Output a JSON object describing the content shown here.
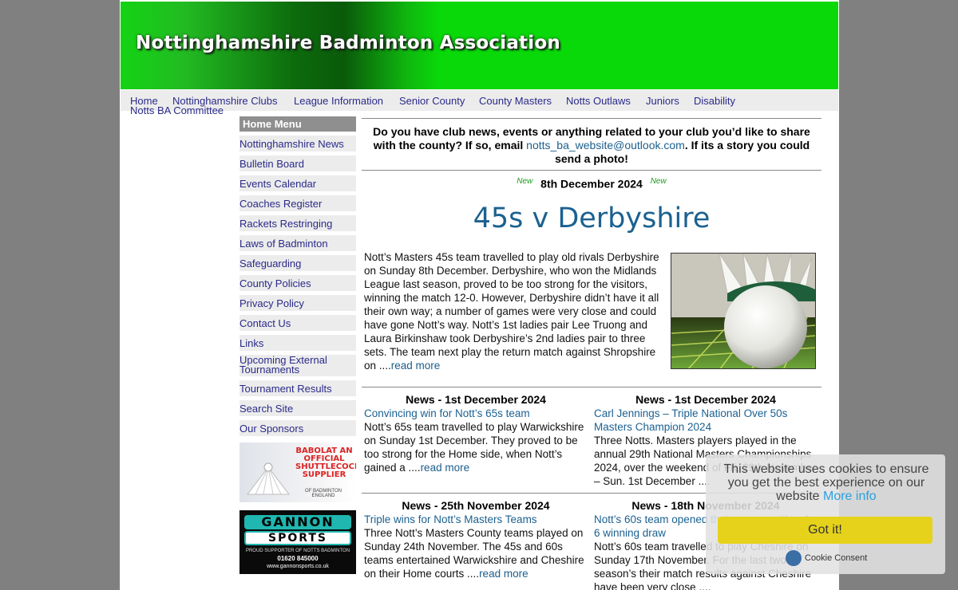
{
  "site": {
    "title": "Nottinghamshire Badminton Association"
  },
  "nav": {
    "items": [
      {
        "label": "Home",
        "name": "nav-home"
      },
      {
        "label": "Nottinghamshire Clubs",
        "name": "nav-clubs"
      },
      {
        "label": "League Information",
        "name": "nav-league"
      },
      {
        "label": "Senior County",
        "name": "nav-senior"
      },
      {
        "label": "County Masters",
        "name": "nav-masters"
      },
      {
        "label": "Notts Outlaws",
        "name": "nav-outlaws"
      },
      {
        "label": "Juniors",
        "name": "nav-juniors"
      },
      {
        "label": "Disability",
        "name": "nav-disability"
      },
      {
        "label": "Notts BA Committee",
        "name": "nav-committee"
      }
    ]
  },
  "sidebar": {
    "title": "Home Menu",
    "items": [
      "Nottinghamshire News",
      "Bulletin Board",
      "Events Calendar",
      "Coaches Register",
      "Rackets Restringing",
      "Laws of Badminton",
      "Safeguarding",
      "County Policies",
      "Privacy Policy",
      "Contact Us",
      "Links",
      "Upcoming External Tournaments",
      "Tournament Results",
      "Search Site",
      "Our Sponsors"
    ]
  },
  "sponsors": {
    "babolat": {
      "text": "BABOLAT AN OFFICIAL SHUTTLECOCK SUPPLIER",
      "sub": "OF BADMINTON ENGLAND"
    },
    "gannon": {
      "line1": "GANNON",
      "line2": "SPORTS",
      "tag": "PROUD SUPPORTER OF NOTTS BADMINTON",
      "phone": "01620 845000",
      "web": "www.gannonsports.co.uk"
    }
  },
  "notice": {
    "text_before": "Do you have club news, events or anything related to your club you’d like to share with the county? If so, email ",
    "email": "notts_ba_website@outlook.com",
    "text_after": ". If its a story you could send a photo!"
  },
  "feature": {
    "new_badge": "New",
    "date": "8th December 2024",
    "headline": "45s v Derbyshire",
    "body": "Nott’s Masters 45s team travelled to play old rivals Derbyshire on Sunday 8th December. Derbyshire, who won the Midlands League last season, proved to be too strong for the visitors, winning the match 12-0. However, Derbyshire didn’t have it all their own way; a number of games were very close and could have gone Nott’s way. Nott’s 1st ladies pair Lee Truong and Laura Birkinshaw took Derbyshire’s 2nd ladies pair to three sets. The team next play the return match against Shropshire on ....",
    "read_more": "read more"
  },
  "news": [
    {
      "heading": "News - 1st December 2024",
      "title": "Convincing win for Nott’s 65s team",
      "body": "Nott’s 65s team travelled to play Warwickshire on Sunday 1st December. They proved to be too strong for the Home side, when Nott’s gained a ....",
      "read_more": "read more"
    },
    {
      "heading": "News - 1st December 2024",
      "title": "Carl Jennings – Triple National Over 50s Masters Champion 2024",
      "body": "Three Notts. Masters players played in the annual 29th National Masters Championships 2024, over the weekend of Fri. 29th November – Sun. 1st December ....",
      "read_more": ""
    },
    {
      "heading": "News - 25th November 2024",
      "title": "Triple wins for Nott’s Masters Teams",
      "body": "Three Nott’s Masters County teams played on Sunday 24th November. The 45s and 60s teams entertained Warwickshire and Cheshire on their Home courts ....",
      "read_more": "read more"
    },
    {
      "heading": "News - 18th November 2024",
      "title": "Nott’s 60s team opened their season with a 6-6 winning draw",
      "body": "Nott’s 60s team travelled to play Cheshire on Sunday 17th November. For the last two season’s their match results against Cheshire have been very close ....",
      "read_more": ""
    }
  ],
  "cookie": {
    "message": "This website uses cookies to ensure you get the best experience on our website",
    "more_info": "More info",
    "button": "Got it!",
    "brand": "Cookie Consent"
  },
  "colors": {
    "banner_green": "#09d909",
    "link_blue": "#1b6190",
    "nav_text": "#2a2a8a",
    "cookie_button": "#e6d21a"
  }
}
